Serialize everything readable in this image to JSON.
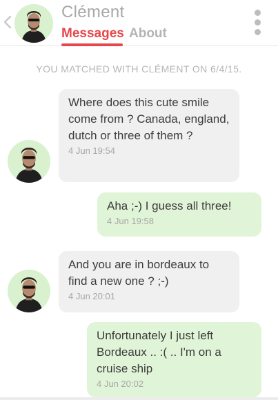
{
  "header": {
    "back_icon": "chevron-left-icon",
    "contact_name": "Clément",
    "tabs": [
      "Messages",
      "About"
    ],
    "active_tab": "Messages",
    "menu_icon": "vertical-dots-icon"
  },
  "match_notice": "YOU MATCHED WITH CLÉMENT ON 6/4/15.",
  "messages": [
    {
      "direction": "in",
      "text": "Where does this cute smile come from ? Canada, england, dutch or three of them ?",
      "time": "4 Jun 19:54"
    },
    {
      "direction": "out",
      "text": "Aha ;-) I guess all three!",
      "time": "4 Jun 19:58"
    },
    {
      "direction": "in",
      "text": "And you are in bordeaux to find a new one ? ;-)",
      "time": "4 Jun 20:01"
    },
    {
      "direction": "out",
      "text": "Unfortunately I just left Bordeaux .. :( .. I'm on a cruise ship",
      "time": "4 Jun 20:02"
    }
  ],
  "colors": {
    "accent": "#e8464a",
    "incoming_bubble": "#f0f0f0",
    "outgoing_bubble": "#e0f5d7",
    "avatar_background": "#d9f1cf"
  }
}
